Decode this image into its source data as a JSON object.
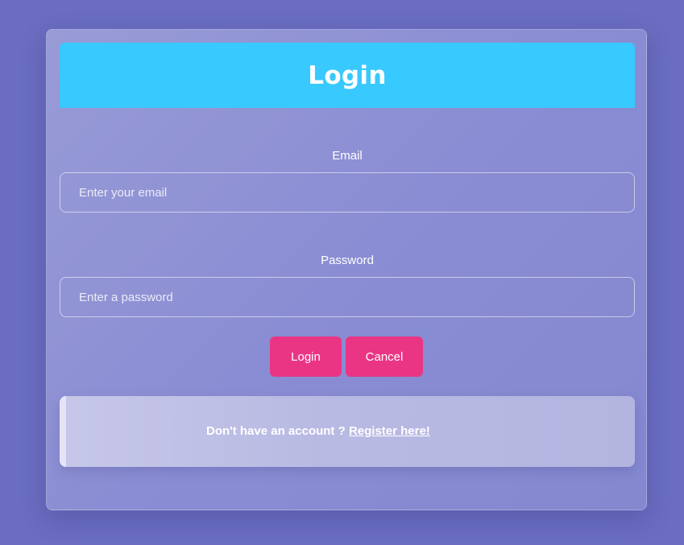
{
  "form": {
    "title": "Login",
    "email_label": "Email",
    "email_placeholder": "Enter your email",
    "email_value": "",
    "password_label": "Password",
    "password_placeholder": "Enter a password",
    "password_value": "",
    "login_button": "Login",
    "cancel_button": "Cancel"
  },
  "register": {
    "prompt": "Don't have an account ?",
    "link": "Register here!"
  },
  "colors": {
    "background": "#6a6dc0",
    "header": "#38c9ff",
    "button": "#ea3585",
    "text": "#ffffff"
  }
}
